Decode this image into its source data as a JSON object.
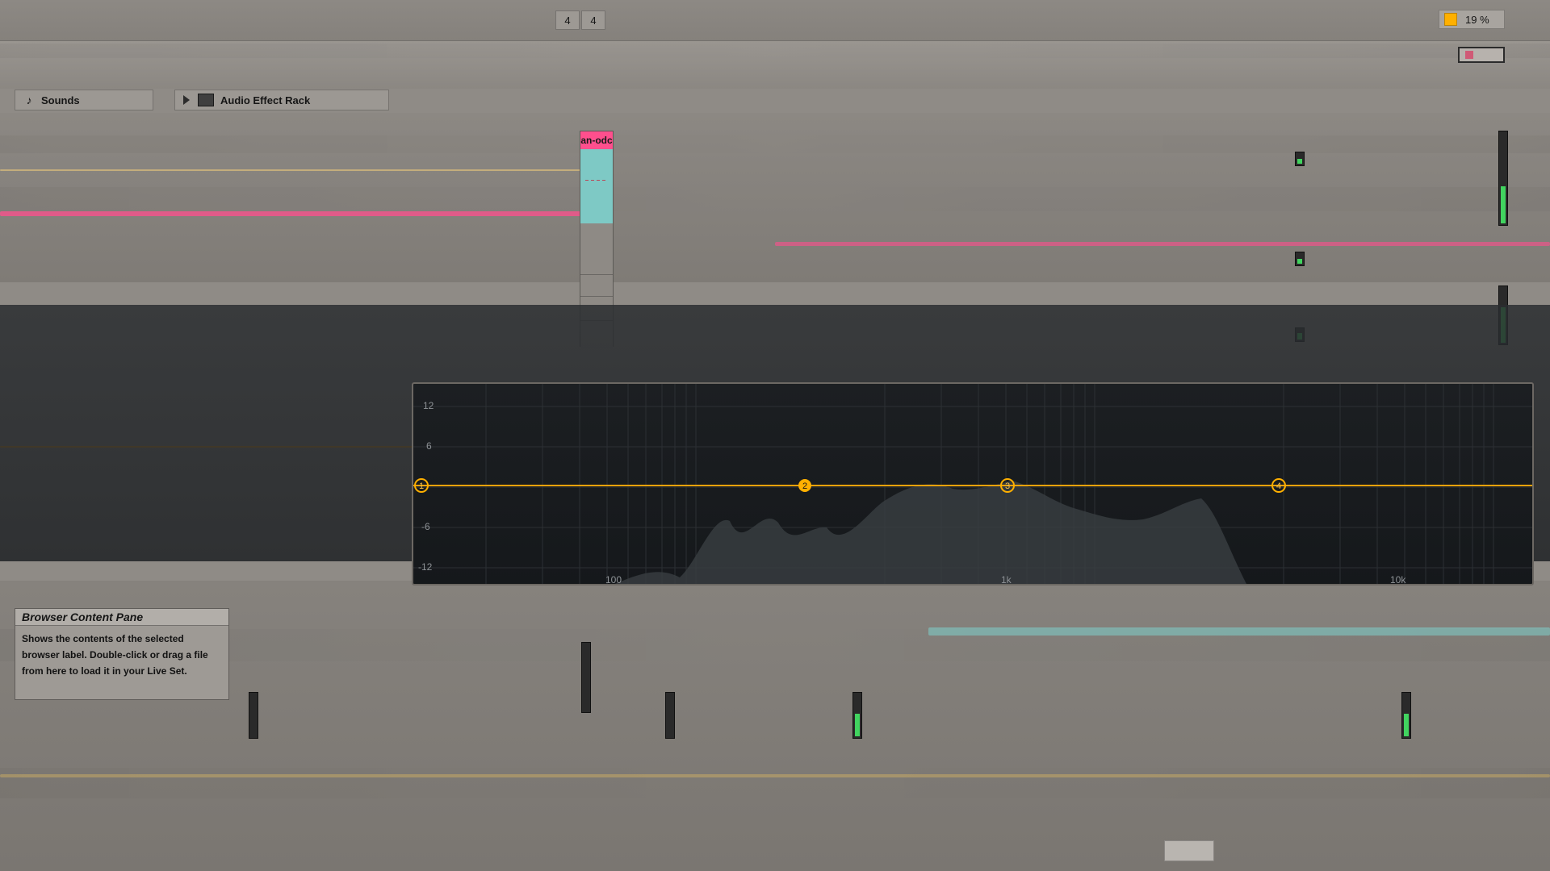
{
  "transport": {
    "signature_numerator": "4",
    "signature_denominator": "4",
    "cpu_load": "19 %"
  },
  "browser": {
    "labels": [
      {
        "label": "Sounds",
        "icon": "music-note-icon"
      },
      {
        "label": "Audio Effect Rack",
        "icon": "audio-effect-rack-icon"
      }
    ]
  },
  "session": {
    "clip_name": "an-odc"
  },
  "eq": {
    "y_ticks": [
      "12",
      "6",
      "-6",
      "-12"
    ],
    "x_ticks": [
      "100",
      "1k",
      "10k"
    ],
    "bands": [
      "1",
      "2",
      "3",
      "4"
    ],
    "colors": {
      "curve": "#f2a20a",
      "band_node": "#ffb000",
      "spectrum": "#3a3e42"
    }
  },
  "info_view": {
    "title": "Browser Content Pane",
    "text": "Shows the contents of the selected browser label. Double-click or drag a file from here to load it in your Live Set."
  },
  "colors": {
    "background": "#8f8b86",
    "accent": "#f2a20a",
    "pink": "#ff4f8d",
    "teal": "#7ec9c5",
    "meter_green": "#41d45f"
  }
}
